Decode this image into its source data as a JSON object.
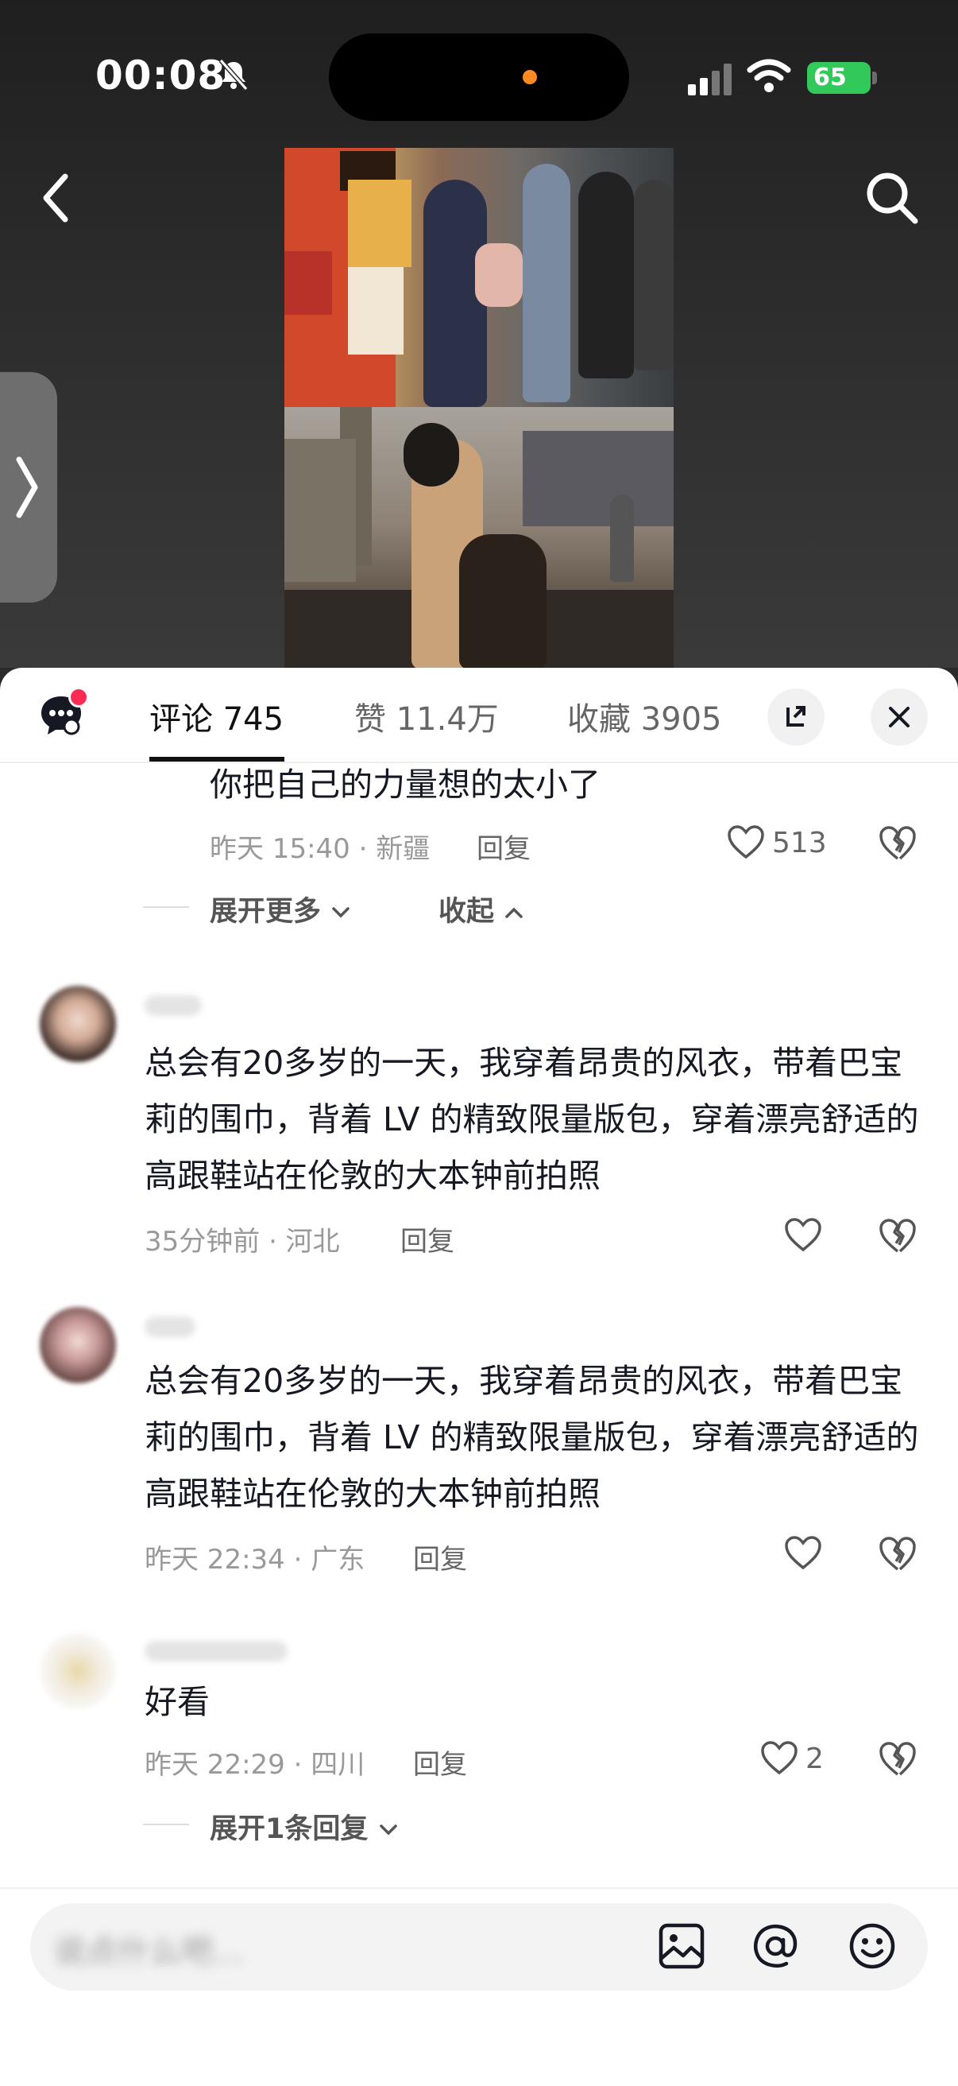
{
  "status": {
    "time": "00:08",
    "battery": "65"
  },
  "tabs": {
    "comments": "评论 745",
    "likes": "赞 11.4万",
    "favorites": "收藏 3905"
  },
  "comments": [
    {
      "text": "你把自己的力量想的太小了",
      "meta": "昨天 15:40 · 新疆",
      "reply": "回复",
      "likes": "513"
    },
    {
      "text": "总会有20多岁的一天，我穿着昂贵的风衣，带着巴宝莉的围巾，背着 LV 的精致限量版包，穿着漂亮舒适的高跟鞋站在伦敦的大本钟前拍照",
      "meta": "35分钟前 · 河北",
      "reply": "回复"
    },
    {
      "text": "总会有20多岁的一天，我穿着昂贵的风衣，带着巴宝莉的围巾，背着 LV 的精致限量版包，穿着漂亮舒适的高跟鞋站在伦敦的大本钟前拍照",
      "meta": "昨天 22:34 · 广东",
      "reply": "回复"
    },
    {
      "text": "好看",
      "meta": "昨天 22:29 · 四川",
      "reply": "回复",
      "likes": "2"
    }
  ],
  "thread": {
    "expand_more": "展开更多",
    "collapse": "收起",
    "expand_one": "展开1条回复"
  },
  "input": {
    "placeholder": "说点什么吧..."
  },
  "colors": {
    "accent": "#fe2c55",
    "battery": "#32c85a"
  },
  "icons": [
    "bell-slash-icon",
    "signal-icon",
    "wifi-icon",
    "back-icon",
    "search-icon",
    "chevron-right-icon",
    "comment-icon",
    "expand-icon",
    "close-icon",
    "heart-icon",
    "broken-heart-icon",
    "chevron-down-icon",
    "chevron-up-icon",
    "image-icon",
    "at-icon",
    "emoji-icon"
  ]
}
